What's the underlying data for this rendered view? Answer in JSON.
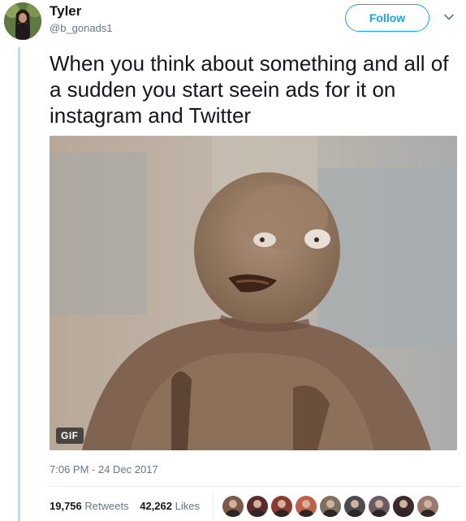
{
  "author": {
    "name": "Tyler",
    "handle": "@b_gonads1"
  },
  "follow_label": "Follow",
  "tweet_text": "When you think about something and all of a sudden you start seein ads for it on instagram and Twitter",
  "media": {
    "type": "GIF",
    "badge": "GIF",
    "icon": "puppet-monkey-gif"
  },
  "timestamp": "7:06 PM - 24 Dec 2017",
  "stats": {
    "retweets_count": "19,756",
    "retweets_label": "Retweets",
    "likes_count": "42,262",
    "likes_label": "Likes"
  },
  "likers": [
    {
      "icon": "liker-avatar-1",
      "color": "#7a5a48"
    },
    {
      "icon": "liker-avatar-2",
      "color": "#5b2b2b"
    },
    {
      "icon": "liker-avatar-3",
      "color": "#8a3a30"
    },
    {
      "icon": "liker-avatar-4",
      "color": "#c0604a"
    },
    {
      "icon": "liker-avatar-5",
      "color": "#7d7060"
    },
    {
      "icon": "liker-avatar-6",
      "color": "#4a4a52"
    },
    {
      "icon": "liker-avatar-7",
      "color": "#6a5a66"
    },
    {
      "icon": "liker-avatar-8",
      "color": "#3a2a2a"
    },
    {
      "icon": "liker-avatar-9",
      "color": "#9a7a70"
    }
  ],
  "colors": {
    "accent": "#1da1f2",
    "thread_line": "#c4d9ec",
    "secondary_text": "#657786"
  }
}
